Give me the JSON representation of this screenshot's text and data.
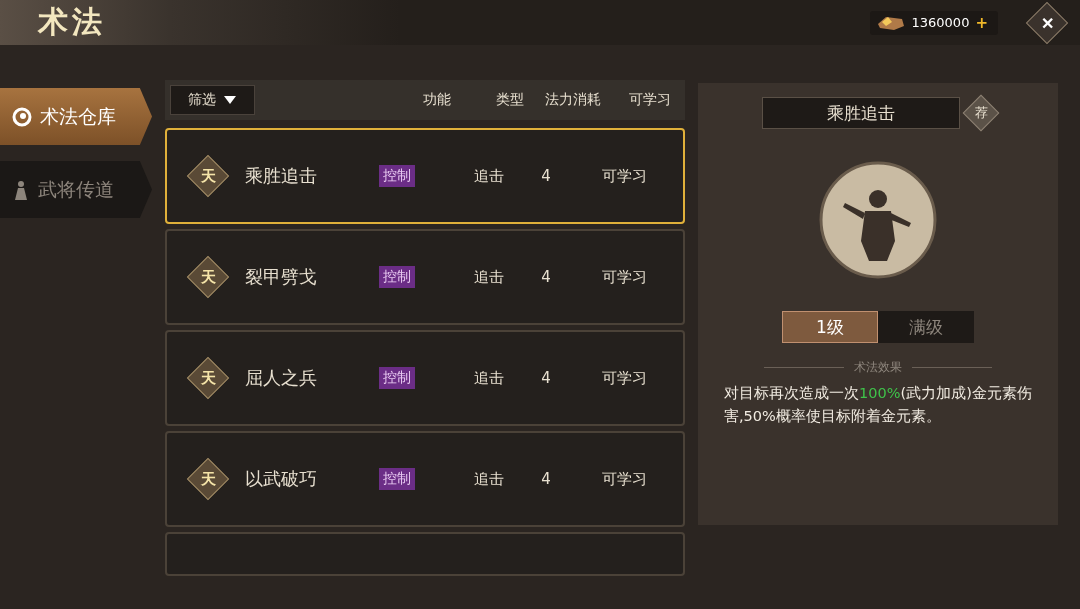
{
  "title": "术法",
  "currency": {
    "amount": "1360000",
    "add": "+"
  },
  "close": {
    "label": "✕"
  },
  "sidebar": {
    "items": [
      {
        "label": "术法仓库",
        "selected": true
      },
      {
        "label": "武将传道",
        "selected": false
      }
    ]
  },
  "filter": {
    "label": "筛选"
  },
  "columns": [
    "功能",
    "类型",
    "法力消耗",
    "可学习"
  ],
  "skills": [
    {
      "grade": "天",
      "name": "乘胜追击",
      "function": "控制",
      "type": "追击",
      "cost": "4",
      "status": "可学习",
      "selected": true
    },
    {
      "grade": "天",
      "name": "裂甲劈戈",
      "function": "控制",
      "type": "追击",
      "cost": "4",
      "status": "可学习",
      "selected": false
    },
    {
      "grade": "天",
      "name": "屈人之兵",
      "function": "控制",
      "type": "追击",
      "cost": "4",
      "status": "可学习",
      "selected": false
    },
    {
      "grade": "天",
      "name": "以武破巧",
      "function": "控制",
      "type": "追击",
      "cost": "4",
      "status": "可学习",
      "selected": false
    }
  ],
  "detail": {
    "name": "乘胜追击",
    "badge": "荐",
    "levels": [
      {
        "label": "1级",
        "selected": true
      },
      {
        "label": "满级",
        "selected": false
      }
    ],
    "section_title": "术法效果",
    "description": [
      {
        "kind": "plain",
        "text": "对目标再次造成一次"
      },
      {
        "kind": "highlight",
        "text": "100%"
      },
      {
        "kind": "plain",
        "text": "(武力加成)金元素伤害,50%概率使目标附着金元素。"
      }
    ]
  }
}
